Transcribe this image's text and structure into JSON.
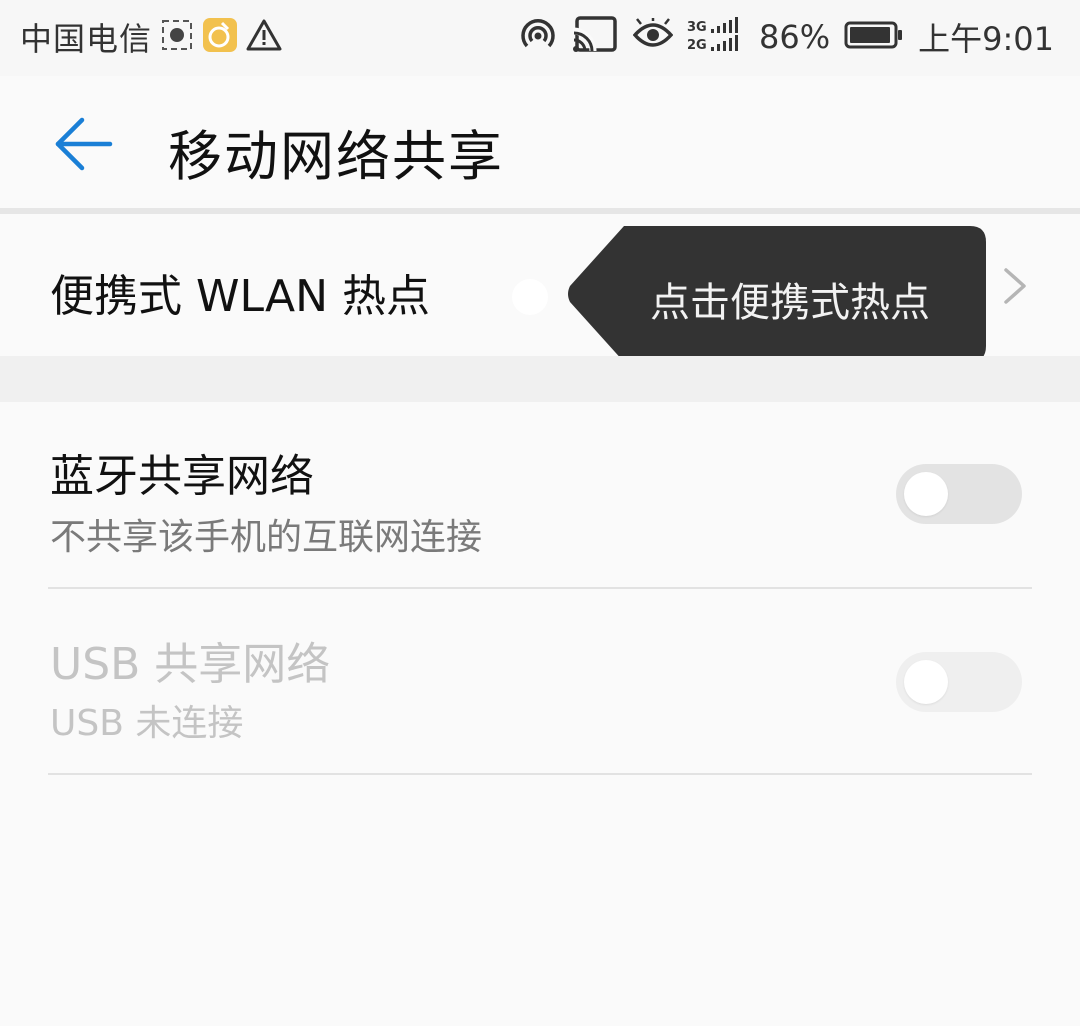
{
  "status_bar": {
    "carrier": "中国电信",
    "battery_percent": "86%",
    "time": "上午9:01",
    "network_label_top": "3G",
    "network_label_bottom": "2G",
    "icons": [
      "screenshot-icon",
      "app-notification-icon",
      "warning-icon",
      "hotspot-icon",
      "cast-icon",
      "eye-icon",
      "signal-icon",
      "battery-icon"
    ]
  },
  "app_bar": {
    "title": "移动网络共享",
    "back_icon": "back-arrow-icon"
  },
  "hotspot_row": {
    "label": "便携式 WLAN 热点",
    "chevron_icon": "chevron-right-icon"
  },
  "tooltip": {
    "text": "点击便携式热点"
  },
  "bluetooth_row": {
    "title": "蓝牙共享网络",
    "subtitle": "不共享该手机的互联网连接",
    "enabled": false
  },
  "usb_row": {
    "title": "USB 共享网络",
    "subtitle": "USB 未连接",
    "enabled": false,
    "disabled": true
  },
  "colors": {
    "accent": "#1a7fd6",
    "tooltip_bg": "#333333",
    "background": "#fafafa"
  }
}
